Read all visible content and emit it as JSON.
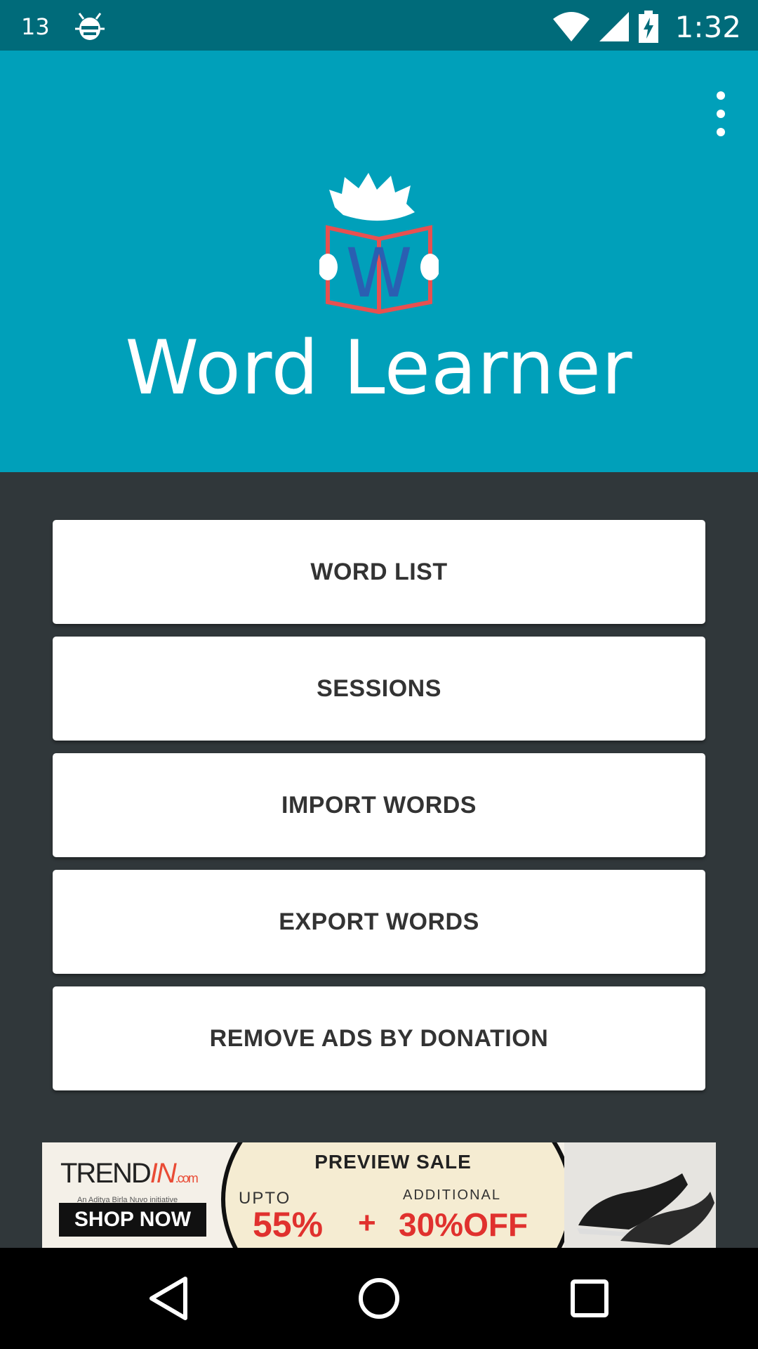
{
  "status_bar": {
    "notification_count": "13",
    "time": "1:32",
    "icons": [
      "debug-bug-icon",
      "wifi-icon",
      "cell-signal-icon",
      "battery-charging-icon"
    ]
  },
  "header": {
    "title": "Word Learner",
    "logo_letter": "W",
    "background_color": "#00a0ba",
    "menu_icon": "overflow-menu-icon"
  },
  "menu": {
    "buttons": [
      {
        "label": "WORD LIST"
      },
      {
        "label": "SESSIONS"
      },
      {
        "label": "IMPORT WORDS"
      },
      {
        "label": "EXPORT WORDS"
      },
      {
        "label": "REMOVE ADS BY DONATION"
      }
    ]
  },
  "ad": {
    "brand_prefix": "TREND",
    "brand_in": "IN",
    "brand_com": ".com",
    "tagline": "An Aditya Birla Nuvo initiative",
    "cta": "SHOP NOW",
    "headline": "PREVIEW SALE",
    "upto": "UPTO",
    "additional": "ADDITIONAL",
    "discount": "55%",
    "plus": "+",
    "extra_off": "30%OFF"
  },
  "nav_bar": {
    "icons": [
      "back-icon",
      "home-icon",
      "recents-icon"
    ]
  }
}
